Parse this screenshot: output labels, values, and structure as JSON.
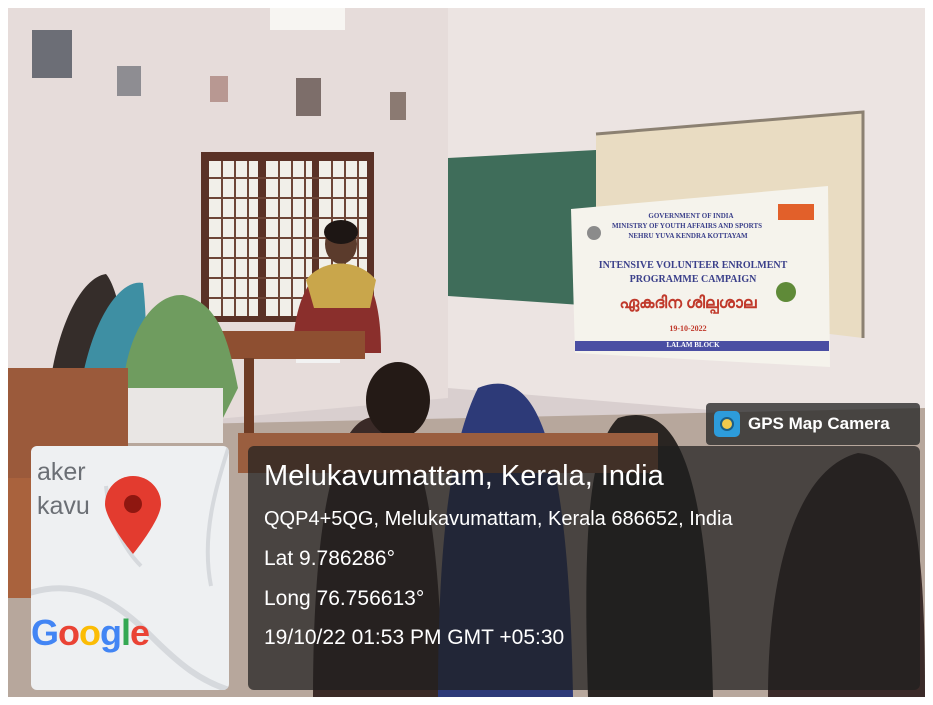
{
  "overlay": {
    "brand_label": "GPS Map Camera",
    "brand_icon": "camera-icon",
    "title": "Melukavumattam, Kerala, India",
    "address": "QQP4+5QG, Melukavumattam, Kerala 686652, India",
    "lat": "Lat 9.786286°",
    "long": "Long 76.756613°",
    "datetime": "19/10/22 01:53 PM GMT +05:30"
  },
  "map": {
    "place_line1": "aker",
    "place_line2": "kavu",
    "pin_icon": "map-pin-icon",
    "logo": "Google",
    "logo_colors": [
      "#4285F4",
      "#EA4335",
      "#FBBC05",
      "#4285F4",
      "#34A853",
      "#EA4335"
    ]
  },
  "banner": {
    "line1": "GOVERNMENT OF INDIA",
    "line2": "MINISTRY OF YOUTH AFFAIRS AND SPORTS",
    "line3": "NEHRU YUVA KENDRA KOTTAYAM",
    "line4": "INTENSIVE VOLUNTEER ENROLMENT",
    "line5": "PROGRAMME CAMPAIGN",
    "line6": "ഏകദിന ശില്പശാല",
    "line7": "19-10-2022",
    "line8": "LALAM BLOCK"
  }
}
